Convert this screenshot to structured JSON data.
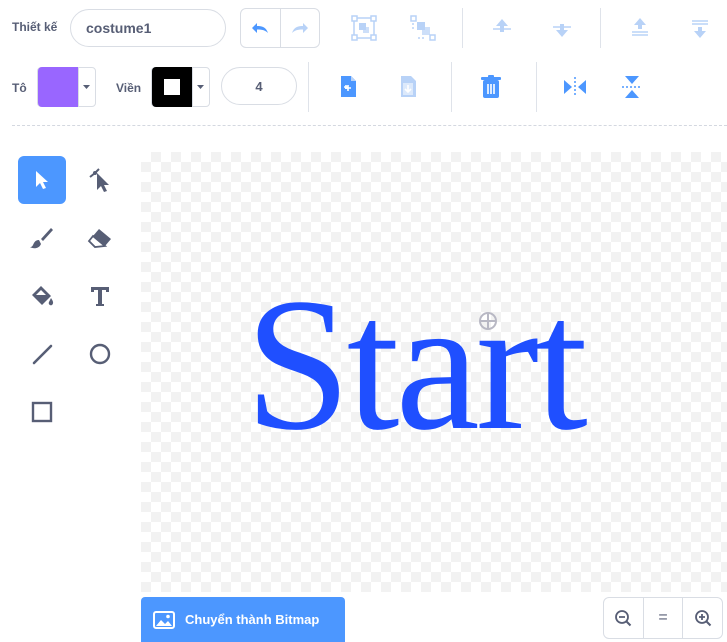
{
  "toolbar": {
    "costume_label": "Thiết kế",
    "costume_name": "costume1",
    "fill_label": "Tô",
    "outline_label": "Viền",
    "outline_width": "4"
  },
  "colors": {
    "fill": "#9966ff",
    "outline": "#000000",
    "accent": "#4c97ff",
    "text_on_canvas": "#1f4fff",
    "toolbar_icon": "#4c97ff",
    "toolbar_icon_disabled": "#b8d2f7"
  },
  "tools": [
    {
      "name": "select",
      "icon": "arrow-icon",
      "active": true
    },
    {
      "name": "reshape",
      "icon": "reshape-icon",
      "active": false
    },
    {
      "name": "brush",
      "icon": "brush-icon",
      "active": false
    },
    {
      "name": "eraser",
      "icon": "eraser-icon",
      "active": false
    },
    {
      "name": "fill",
      "icon": "fill-bucket-icon",
      "active": false
    },
    {
      "name": "text",
      "icon": "text-icon",
      "active": false
    },
    {
      "name": "line",
      "icon": "line-icon",
      "active": false
    },
    {
      "name": "circle",
      "icon": "circle-icon",
      "active": false
    },
    {
      "name": "rectangle",
      "icon": "rectangle-icon",
      "active": false
    }
  ],
  "canvas": {
    "text": "Start"
  },
  "bottom": {
    "convert_label": "Chuyển thành Bitmap",
    "zoom_reset_label": "="
  }
}
